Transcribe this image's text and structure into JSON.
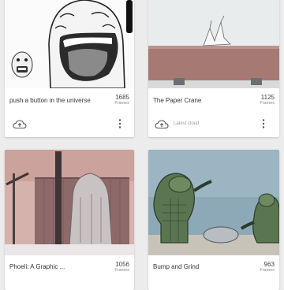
{
  "cards": [
    {
      "title": "push a button in the universe",
      "frames": "1685",
      "frames_label": "Frames",
      "status": ""
    },
    {
      "title": "The Paper Crane",
      "frames": "1125",
      "frames_label": "Frames",
      "status": "Latest cloud"
    },
    {
      "title": "Phoeli: A Graphic ...",
      "frames": "1056",
      "frames_label": "Frames",
      "status": ""
    },
    {
      "title": "Bump and Grind",
      "frames": "963",
      "frames_label": "Frames",
      "status": ""
    }
  ]
}
